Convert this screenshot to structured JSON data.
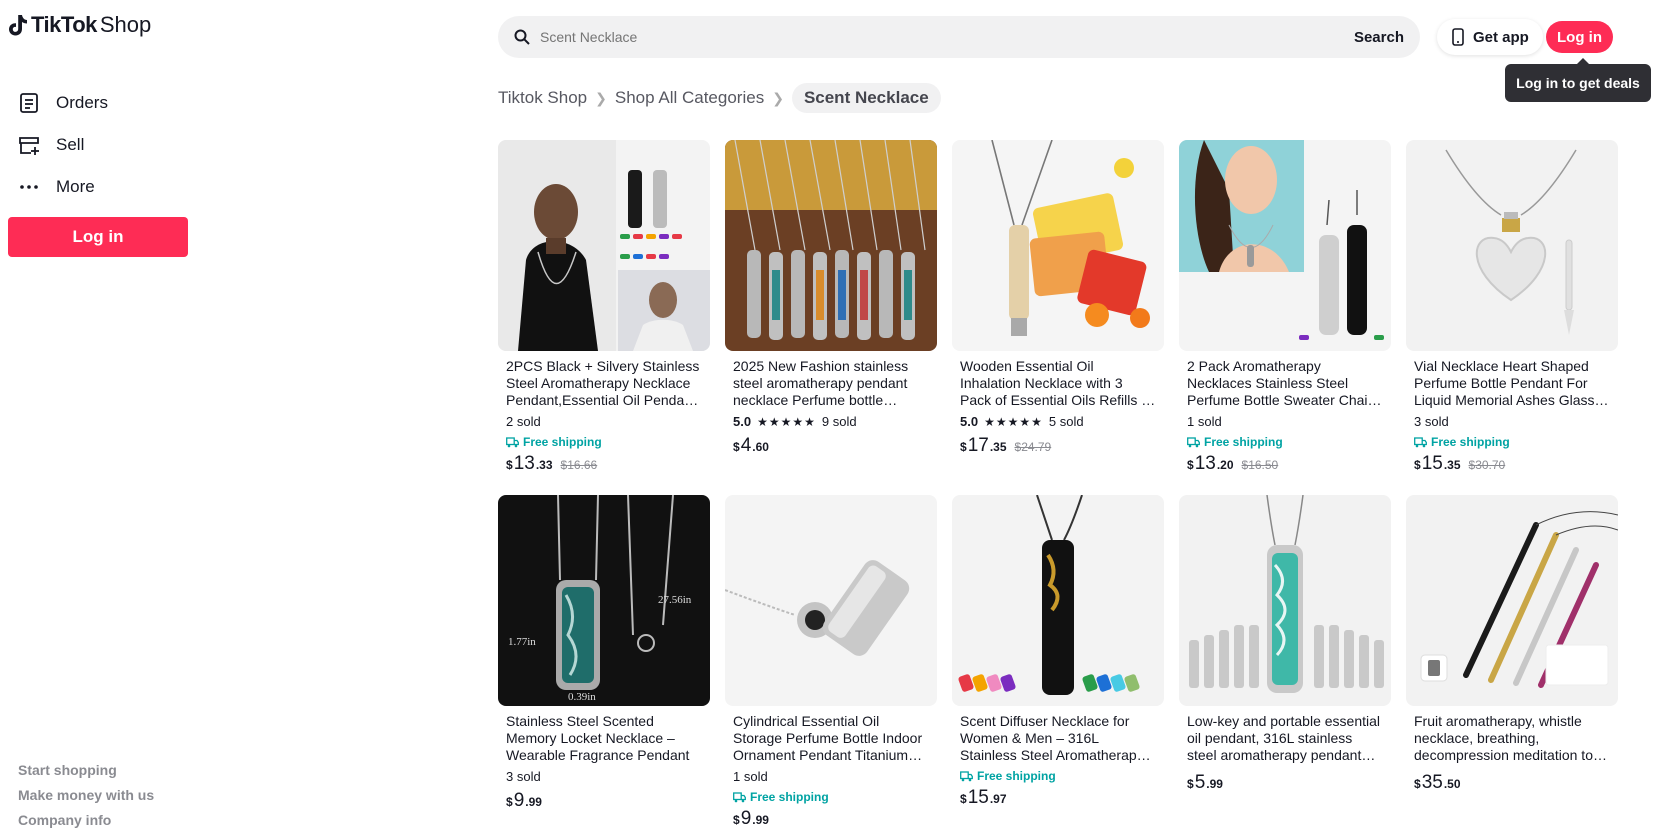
{
  "sidebar": {
    "logo_tiktok": "TikTok",
    "logo_shop": "Shop",
    "items": [
      {
        "label": "Orders",
        "icon": "orders-icon"
      },
      {
        "label": "Sell",
        "icon": "sell-icon"
      },
      {
        "label": "More",
        "icon": "more-icon"
      }
    ],
    "login_label": "Log in",
    "footer": [
      "Start shopping",
      "Make money with us",
      "Company info"
    ]
  },
  "header": {
    "search_placeholder": "Scent Necklace",
    "search_label": "Search",
    "get_app_label": "Get app",
    "login_label": "Log in",
    "tooltip": "Log in to get deals"
  },
  "breadcrumb": [
    "Tiktok Shop",
    "Shop All Categories",
    "Scent Necklace"
  ],
  "products": [
    {
      "title": "2PCS Black + Silvery Stainless Steel Aromatherapy Necklace Pendant,Essential Oil Pendant ...",
      "rating": "",
      "sold": "2 sold",
      "free_shipping": "Free shipping",
      "price_int": "13",
      "price_dec": ".33",
      "price_orig": "$16.66"
    },
    {
      "title": "2025 New Fashion stainless steel aromatherapy pendant necklace Perfume bottle Essential o...",
      "rating": "5.0",
      "sold": "9 sold",
      "free_shipping": "",
      "price_int": "4",
      "price_dec": ".60",
      "price_orig": ""
    },
    {
      "title": "Wooden Essential Oil Inhalation Necklace with 3 Pack of Essential Oils Refills & Fragrance Exp...",
      "rating": "5.0",
      "sold": "5 sold",
      "free_shipping": "",
      "price_int": "17",
      "price_dec": ".35",
      "price_orig": "$24.79"
    },
    {
      "title": "2 Pack Aromatherapy Necklaces Stainless Steel Perfume Bottle Sweater Chain Fragrance Neck...",
      "rating": "",
      "sold": "1 sold",
      "free_shipping": "Free shipping",
      "price_int": "13",
      "price_dec": ".20",
      "price_orig": "$16.50"
    },
    {
      "title": "Vial Necklace Heart Shaped Perfume Bottle Pendant For Liquid Memorial Ashes Glass Keepsa...",
      "rating": "",
      "sold": "3 sold",
      "free_shipping": "Free shipping",
      "price_int": "15",
      "price_dec": ".35",
      "price_orig": "$30.70"
    },
    {
      "title": "Stainless Steel Scented Memory Locket Necklace – Wearable Fragrance Pendant",
      "rating": "",
      "sold": "3 sold",
      "free_shipping": "",
      "price_int": "9",
      "price_dec": ".99",
      "price_orig": ""
    },
    {
      "title": "Cylindrical Essential Oil Storage Perfume Bottle Indoor Ornament Pendant Titanium Steel Arom...",
      "rating": "",
      "sold": "1 sold",
      "free_shipping": "Free shipping",
      "price_int": "9",
      "price_dec": ".99",
      "price_orig": ""
    },
    {
      "title": "Scent Diffuser Necklace for Women & Men – 316L Stainless Steel Aromatherapy Pendant with...",
      "rating": "",
      "sold": "",
      "free_shipping": "Free shipping",
      "price_int": "15",
      "price_dec": ".97",
      "price_orig": ""
    },
    {
      "title": "Low-key and portable essential oil pendant, 316L stainless steel aromatherapy pendant diffusi...",
      "rating": "",
      "sold": "",
      "free_shipping": "",
      "price_int": "5",
      "price_dec": ".99",
      "price_orig": ""
    },
    {
      "title": "Fruit aromatherapy, whistle necklace, breathing, decompression meditation to relieve anxiety...",
      "rating": "",
      "sold": "",
      "free_shipping": "",
      "price_int": "35",
      "price_dec": ".50",
      "price_orig": ""
    }
  ],
  "colors": {
    "accent": "#fe2c55",
    "shipping": "#00a3a3"
  }
}
